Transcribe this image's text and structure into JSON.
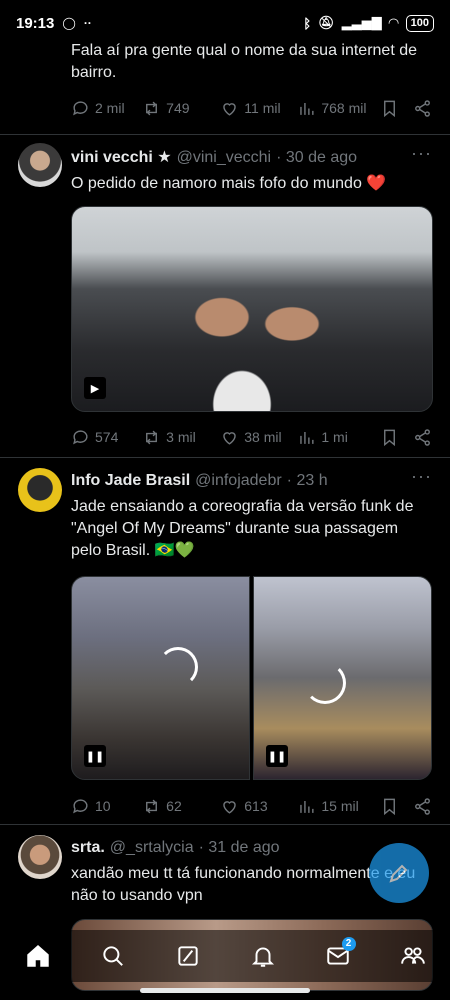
{
  "status": {
    "time": "19:13",
    "battery": "100"
  },
  "tweets": [
    {
      "text": "Fala aí pra gente qual o nome da sua internet de bairro.",
      "replies": "2 mil",
      "retweets": "749",
      "likes": "11 mil",
      "views": "768 mil"
    },
    {
      "name": "vini vecchi ★",
      "handle": "@vini_vecchi",
      "time": "· 30 de ago",
      "text": "O pedido de namoro mais fofo do mundo ❤️",
      "replies": "574",
      "retweets": "3 mil",
      "likes": "38 mil",
      "views": "1 mi"
    },
    {
      "name": "Info Jade Brasil",
      "handle": "@infojadebr",
      "time": "· 23 h",
      "text": "Jade ensaiando a coreografia da versão funk de \"Angel Of My Dreams\" durante sua passagem pelo Brasil. 🇧🇷💚",
      "replies": "10",
      "retweets": "62",
      "likes": "613",
      "views": "15 mil"
    },
    {
      "name": "srta.",
      "handle": "@_srtalycia",
      "time": "· 31 de ago",
      "text": "xandão meu tt tá funcionando normalmente e eu não to usando vpn"
    }
  ],
  "nav": {
    "messages_badge": "2"
  },
  "icons": [
    "whatsapp-icon",
    "bluetooth-icon",
    "mute-icon",
    "signal-icon",
    "wifi-icon",
    "battery-icon",
    "reply-icon",
    "retweet-icon",
    "like-icon",
    "views-icon",
    "bookmark-icon",
    "share-icon",
    "home-icon",
    "search-icon",
    "grok-icon",
    "notifications-icon",
    "messages-icon",
    "communities-icon",
    "compose-icon"
  ],
  "colors": {
    "accent": "#1d9bf0",
    "muted": "#71767b",
    "text": "#e7e9ea",
    "divider": "#2f3336"
  }
}
